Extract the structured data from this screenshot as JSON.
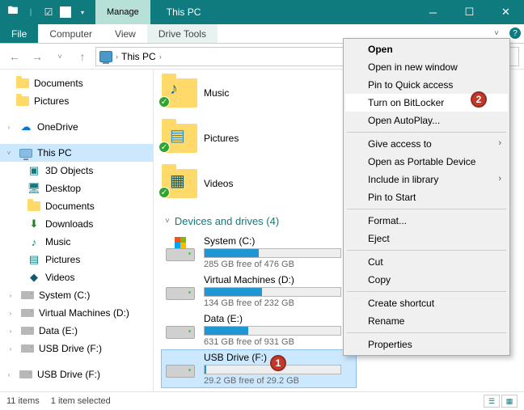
{
  "titlebar": {
    "manage": "Manage",
    "drivetools": "Drive Tools",
    "title": "This PC"
  },
  "ribbon": {
    "file": "File",
    "computer": "Computer",
    "view": "View",
    "drivetools": "Drive Tools"
  },
  "breadcrumb": {
    "loc": "This PC"
  },
  "nav": {
    "documents": "Documents",
    "pictures": "Pictures",
    "onedrive": "OneDrive",
    "thispc": "This PC",
    "objects3d": "3D Objects",
    "desktop": "Desktop",
    "documents2": "Documents",
    "downloads": "Downloads",
    "music": "Music",
    "pictures2": "Pictures",
    "videos": "Videos",
    "systemc": "System (C:)",
    "vm": "Virtual Machines (D:)",
    "data": "Data (E:)",
    "usb": "USB Drive (F:)",
    "usb2": "USB Drive (F:)"
  },
  "sections": {
    "devices": "Devices and drives (4)"
  },
  "folders": {
    "music": "Music",
    "pictures": "Pictures",
    "videos": "Videos"
  },
  "drives": [
    {
      "name": "System (C:)",
      "free": "285 GB free of 476 GB",
      "pct": 40,
      "win": true
    },
    {
      "name": "Virtual Machines (D:)",
      "free": "134 GB free of 232 GB",
      "pct": 42
    },
    {
      "name": "Data (E:)",
      "free": "631 GB free of 931 GB",
      "pct": 32
    },
    {
      "name": "USB Drive (F:)",
      "free": "29.2 GB free of 29.2 GB",
      "pct": 1,
      "sel": true
    }
  ],
  "ctx": {
    "open": "Open",
    "opennew": "Open in new window",
    "pin": "Pin to Quick access",
    "bitlocker": "Turn on BitLocker",
    "autoplay": "Open AutoPlay...",
    "giveaccess": "Give access to",
    "portable": "Open as Portable Device",
    "include": "Include in library",
    "pinstart": "Pin to Start",
    "format": "Format...",
    "eject": "Eject",
    "cut": "Cut",
    "copy": "Copy",
    "shortcut": "Create shortcut",
    "rename": "Rename",
    "properties": "Properties"
  },
  "status": {
    "items": "11 items",
    "selected": "1 item selected"
  },
  "badges": {
    "b1": "1",
    "b2": "2"
  }
}
